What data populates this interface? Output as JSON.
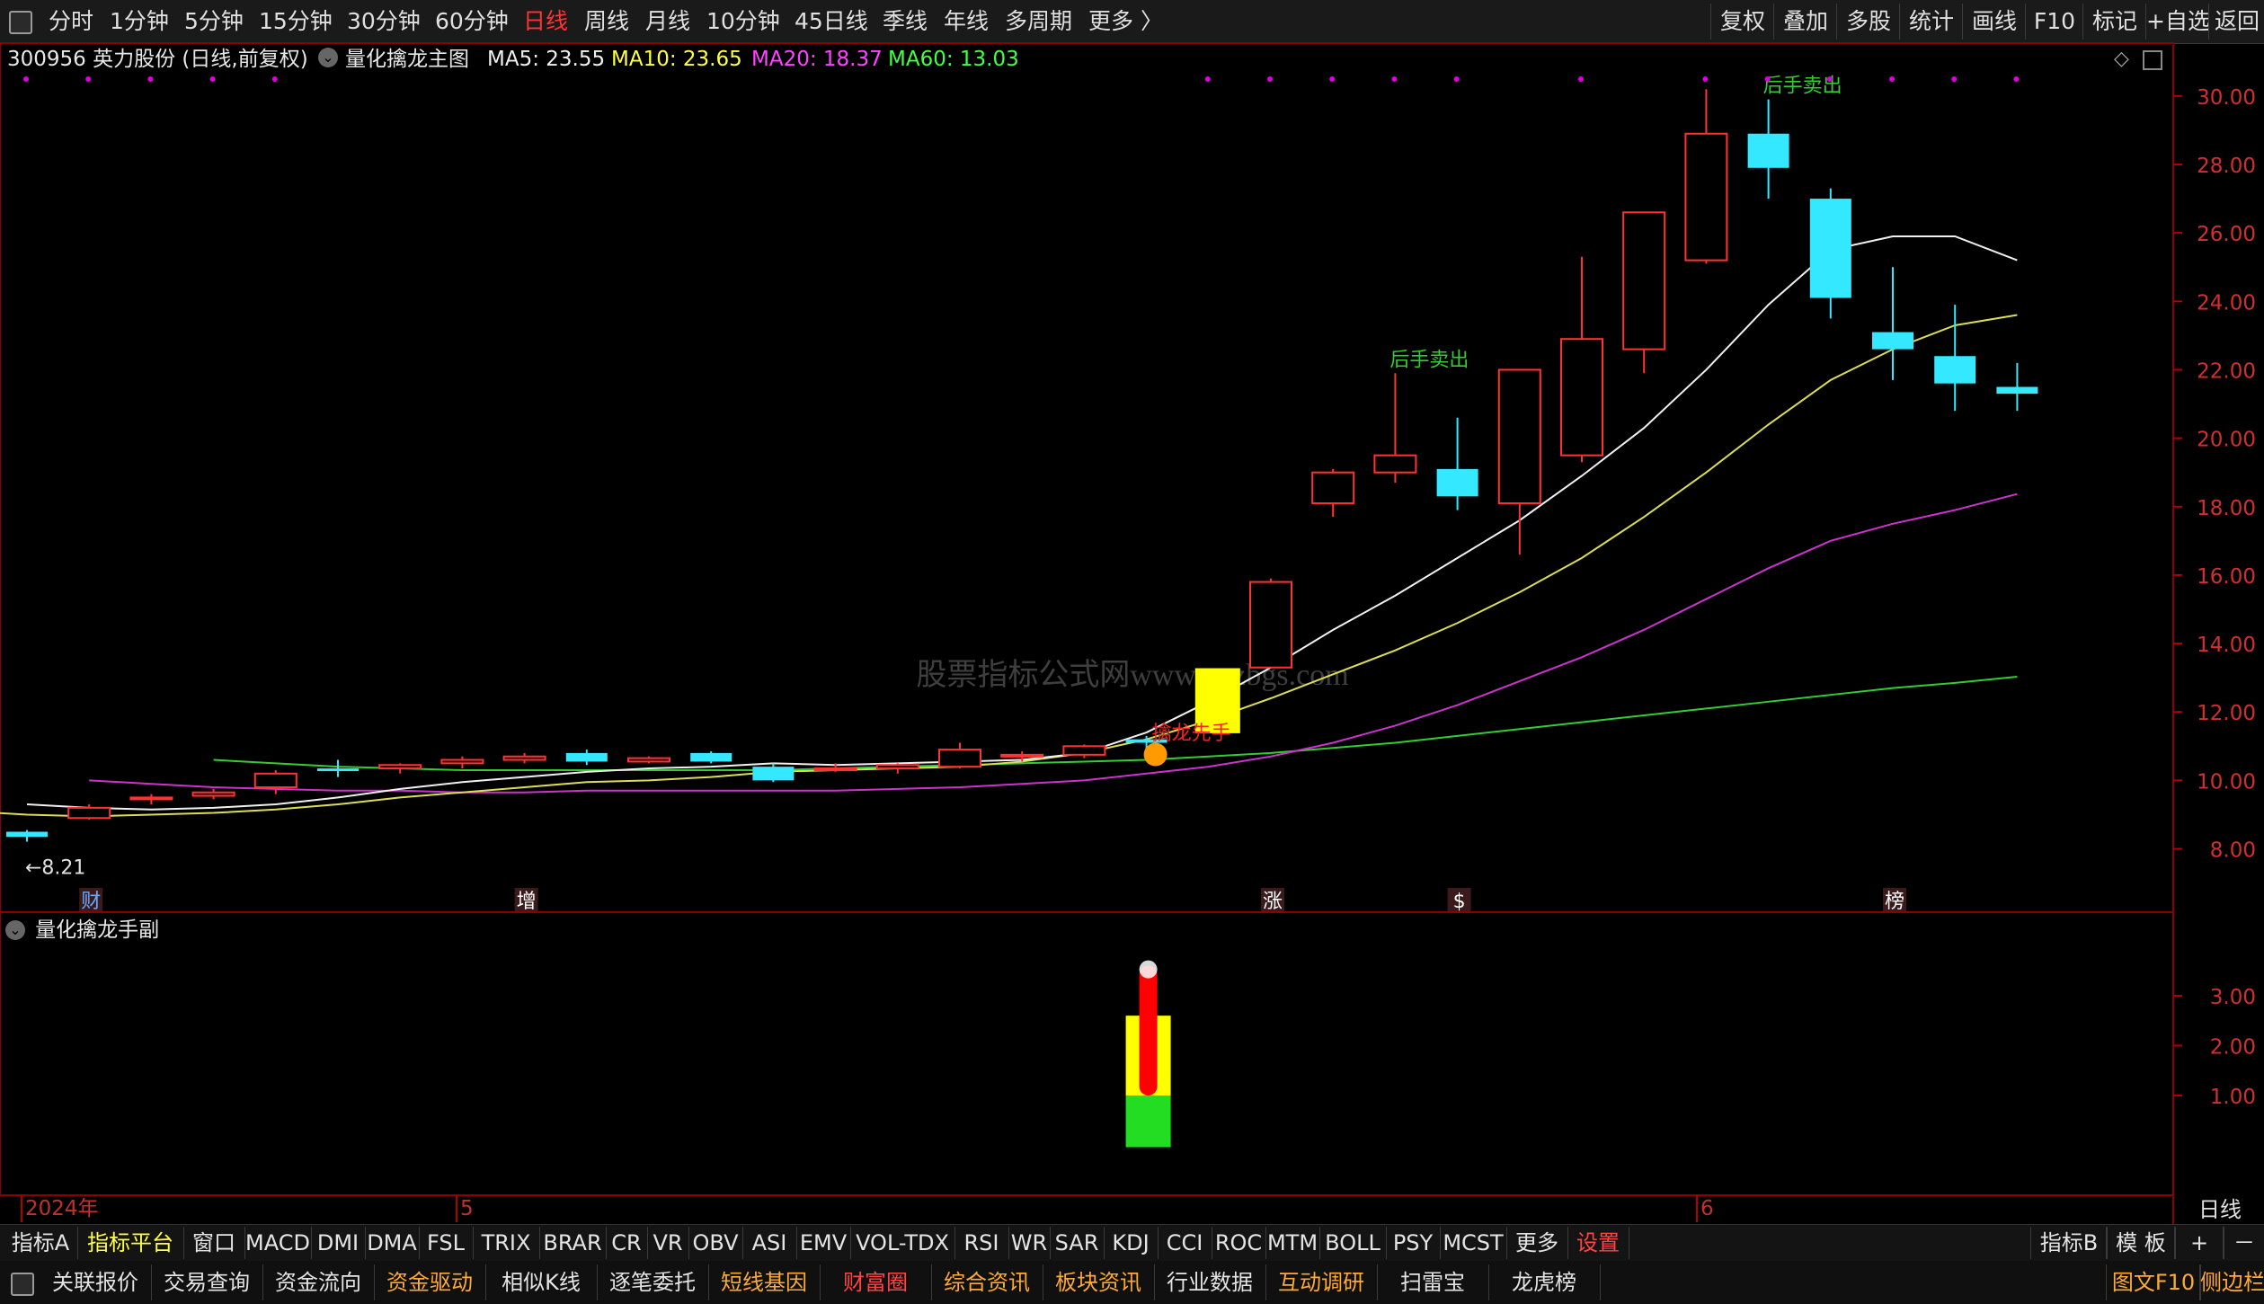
{
  "top_toolbar": {
    "periods": [
      "分时",
      "1分钟",
      "5分钟",
      "15分钟",
      "30分钟",
      "60分钟",
      "日线",
      "周线",
      "月线",
      "10分钟",
      "45日线",
      "季线",
      "年线",
      "多周期",
      "更多 〉"
    ],
    "active_period": "日线",
    "right_buttons": [
      "复权",
      "叠加",
      "多股",
      "统计",
      "画线",
      "F10",
      "标记",
      "+自选",
      "返回"
    ]
  },
  "main_info": {
    "stock": "300956 英力股份 (日线,前复权)",
    "indicator_name": "量化擒龙主图",
    "ma5": "MA5: 23.55",
    "ma10": "MA10: 23.65",
    "ma20": "MA20: 18.37",
    "ma60": "MA60: 13.03",
    "colors": {
      "ma5": "#ffffff",
      "ma10": "#ffff44",
      "ma20": "#ff44ff",
      "ma60": "#44ff44"
    }
  },
  "sub_info": {
    "indicator_name": "量化擒龙手副"
  },
  "watermark": "股票指标公式网www.gpzbgs.com",
  "chart_data": {
    "type": "candlestick",
    "price_axis": {
      "labels": [
        "30.00",
        "28.00",
        "26.00",
        "24.00",
        "22.00",
        "20.00",
        "18.00",
        "16.00",
        "14.00",
        "12.00",
        "10.00",
        "8.00"
      ],
      "ylim": [
        7.2,
        30.6
      ]
    },
    "sub_axis": {
      "labels": [
        "3.00",
        "2.00",
        "1.00"
      ],
      "ylim": [
        -1.0,
        3.9
      ]
    },
    "date_labels": [
      "2024年",
      "5",
      "6"
    ],
    "period_label": "日线",
    "low_marker": "8.21",
    "candles": [
      {
        "o": 8.5,
        "h": 8.55,
        "l": 8.21,
        "c": 8.35
      },
      {
        "o": 8.9,
        "h": 9.3,
        "l": 8.85,
        "c": 9.2
      },
      {
        "o": 9.45,
        "h": 9.6,
        "l": 9.3,
        "c": 9.5
      },
      {
        "o": 9.55,
        "h": 9.75,
        "l": 9.45,
        "c": 9.65
      },
      {
        "o": 9.8,
        "h": 10.3,
        "l": 9.6,
        "c": 10.2
      },
      {
        "o": 10.35,
        "h": 10.6,
        "l": 10.1,
        "c": 10.3
      },
      {
        "o": 10.35,
        "h": 10.5,
        "l": 10.2,
        "c": 10.45
      },
      {
        "o": 10.5,
        "h": 10.7,
        "l": 10.35,
        "c": 10.6
      },
      {
        "o": 10.6,
        "h": 10.8,
        "l": 10.5,
        "c": 10.7
      },
      {
        "o": 10.8,
        "h": 10.9,
        "l": 10.45,
        "c": 10.55
      },
      {
        "o": 10.55,
        "h": 10.7,
        "l": 10.5,
        "c": 10.65
      },
      {
        "o": 10.8,
        "h": 10.85,
        "l": 10.5,
        "c": 10.55
      },
      {
        "o": 10.4,
        "h": 10.5,
        "l": 9.95,
        "c": 10.0
      },
      {
        "o": 10.35,
        "h": 10.5,
        "l": 10.25,
        "c": 10.35
      },
      {
        "o": 10.35,
        "h": 10.5,
        "l": 10.2,
        "c": 10.45
      },
      {
        "o": 10.4,
        "h": 11.1,
        "l": 10.35,
        "c": 10.9
      },
      {
        "o": 10.75,
        "h": 10.85,
        "l": 10.55,
        "c": 10.75
      },
      {
        "o": 10.75,
        "h": 11.05,
        "l": 10.65,
        "c": 11.0
      },
      {
        "o": 11.2,
        "h": 11.3,
        "l": 10.6,
        "c": 11.1
      },
      {
        "o": 13.2,
        "h": 13.2,
        "l": 12.0,
        "c": 12.2
      },
      {
        "o": 13.3,
        "h": 15.9,
        "l": 13.3,
        "c": 15.8
      },
      {
        "o": 18.1,
        "h": 19.1,
        "l": 17.7,
        "c": 19.0
      },
      {
        "o": 19.0,
        "h": 21.9,
        "l": 18.7,
        "c": 19.5
      },
      {
        "o": 19.1,
        "h": 20.6,
        "l": 17.9,
        "c": 18.3
      },
      {
        "o": 18.1,
        "h": 22.0,
        "l": 16.6,
        "c": 22.0
      },
      {
        "o": 19.5,
        "h": 25.3,
        "l": 19.3,
        "c": 22.9
      },
      {
        "o": 22.6,
        "h": 26.6,
        "l": 21.9,
        "c": 26.6
      },
      {
        "o": 25.2,
        "h": 30.2,
        "l": 25.1,
        "c": 28.9
      },
      {
        "o": 28.9,
        "h": 29.9,
        "l": 27.0,
        "c": 27.9
      },
      {
        "o": 27.0,
        "h": 27.3,
        "l": 23.5,
        "c": 24.1
      },
      {
        "o": 23.1,
        "h": 25.0,
        "l": 21.7,
        "c": 22.6
      },
      {
        "o": 22.4,
        "h": 23.9,
        "l": 20.8,
        "c": 21.6
      },
      {
        "o": 21.5,
        "h": 22.2,
        "l": 20.8,
        "c": 21.3
      }
    ],
    "ma5": [
      9.3,
      9.2,
      9.15,
      9.2,
      9.3,
      9.5,
      9.75,
      9.95,
      10.1,
      10.25,
      10.35,
      10.4,
      10.5,
      10.45,
      10.5,
      10.55,
      10.6,
      10.8,
      11.4,
      12.3,
      13.3,
      14.4,
      15.4,
      16.5,
      17.6,
      18.9,
      20.3,
      22.0,
      23.9,
      25.5,
      25.9,
      25.9,
      25.2
    ],
    "ma10": [
      9.1,
      9.0,
      8.95,
      9.0,
      9.05,
      9.15,
      9.3,
      9.5,
      9.65,
      9.8,
      9.95,
      10.0,
      10.1,
      10.25,
      10.3,
      10.35,
      10.4,
      10.55,
      10.8,
      11.2,
      11.75,
      12.4,
      13.1,
      13.8,
      14.6,
      15.5,
      16.5,
      17.7,
      19.0,
      20.4,
      21.7,
      22.6,
      23.3,
      23.6
    ],
    "ma20": [
      10.0,
      9.9,
      9.8,
      9.75,
      9.7,
      9.7,
      9.65,
      9.65,
      9.7,
      9.7,
      9.7,
      9.7,
      9.7,
      9.75,
      9.8,
      9.9,
      10.0,
      10.2,
      10.4,
      10.7,
      11.1,
      11.6,
      12.2,
      12.9,
      13.6,
      14.4,
      15.3,
      16.2,
      17.0,
      17.5,
      17.9,
      18.37
    ],
    "ma60": [
      10.6,
      10.5,
      10.4,
      10.35,
      10.3,
      10.3,
      10.3,
      10.3,
      10.3,
      10.3,
      10.35,
      10.4,
      10.45,
      10.5,
      10.55,
      10.6,
      10.7,
      10.8,
      10.95,
      11.1,
      11.3,
      11.5,
      11.7,
      11.9,
      12.1,
      12.3,
      12.5,
      12.7,
      12.85,
      13.03
    ],
    "signals": [
      {
        "text": "擒龙先手",
        "index": 18,
        "color": "#ff2020"
      },
      {
        "text": "后手卖出",
        "index": 22,
        "color": "#33cc33"
      },
      {
        "text": "后手卖出",
        "index": 28,
        "color": "#33cc33"
      }
    ],
    "event_badges": [
      {
        "text": "财",
        "index": 1
      },
      {
        "text": "增",
        "index": 8
      },
      {
        "text": "涨",
        "index": 20
      },
      {
        "text": "$",
        "index": 23
      },
      {
        "text": "榜",
        "index": 30
      }
    ],
    "sub_bars": {
      "index": 18,
      "green": [
        0,
        1.0
      ],
      "yellow": [
        1.0,
        2.6
      ],
      "red": [
        1.0,
        3.6
      ]
    }
  },
  "indicator_tabs": [
    "指标A",
    "指标平台",
    "窗口",
    "MACD",
    "DMI",
    "DMA",
    "FSL",
    "TRIX",
    "BRAR",
    "CR",
    "VR",
    "OBV",
    "ASI",
    "EMV",
    "VOL-TDX",
    "RSI",
    "WR",
    "SAR",
    "KDJ",
    "CCI",
    "ROC",
    "MTM",
    "BOLL",
    "PSY",
    "MCST",
    "更多",
    "设置"
  ],
  "indicator_right": [
    "指标B",
    "模 板",
    "+",
    "－"
  ],
  "bottom_tabs": [
    "关联报价",
    "交易查询",
    "资金流向",
    "资金驱动",
    "相似K线",
    "逐笔委托",
    "短线基因",
    "财富圈",
    "综合资讯",
    "板块资讯",
    "行业数据",
    "互动调研",
    "扫雷宝",
    "龙虎榜"
  ],
  "bottom_right": [
    "图文F10",
    "侧边栏"
  ]
}
